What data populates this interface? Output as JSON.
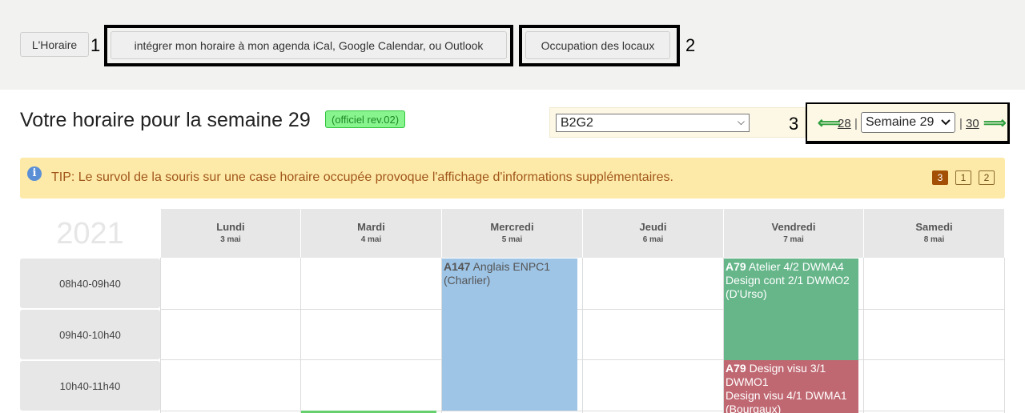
{
  "topbar": {
    "horaire_label": "L'Horaire",
    "ical_label": "intégrer mon horaire à mon agenda iCal, Google Calendar, ou Outlook",
    "locaux_label": "Occupation des locaux",
    "annotations": [
      "1",
      "2",
      "3"
    ]
  },
  "header": {
    "title": "Votre horaire pour la semaine 29",
    "badge": "(officiel rev.02)"
  },
  "group_select": {
    "value": "B2G2"
  },
  "week_nav": {
    "prev_week": "28",
    "current_week": "Semaine 29",
    "next_week": "30",
    "prev_arrow": "⟸",
    "next_arrow": "⟹",
    "separator": "|"
  },
  "tip": {
    "icon": "i",
    "text": "TIP: Le survol de la souris sur une case horaire occupée provoque l'affichage d'informations supplémentaires.",
    "pages": [
      "3",
      "1",
      "2"
    ]
  },
  "calendar": {
    "year": "2021",
    "days": [
      {
        "name": "Lundi",
        "date": "3 mai"
      },
      {
        "name": "Mardi",
        "date": "4 mai"
      },
      {
        "name": "Mercredi",
        "date": "5 mai"
      },
      {
        "name": "Jeudi",
        "date": "6 mai"
      },
      {
        "name": "Vendredi",
        "date": "7 mai"
      },
      {
        "name": "Samedi",
        "date": "8 mai"
      }
    ],
    "timeslots": [
      "08h40-09h40",
      "09h40-10h40",
      "10h40-11h40"
    ],
    "events": [
      {
        "room": "A147",
        "text": "Anglais ENPC1",
        "extra": "",
        "teacher": "(Charlier)"
      },
      {
        "room": "A79",
        "text": "Atelier 4/2 DWMA4",
        "extra": "Design cont 2/1 DWMO2",
        "teacher": "(D'Urso)"
      },
      {
        "room": "A79",
        "text": "Design visu 3/1",
        "extra": "DWMO1",
        "extra2": "Design visu 4/1 DWMA1",
        "teacher": "(Bourgaux)"
      }
    ]
  },
  "colors": {
    "event_blue": "#9ec4e6",
    "event_green": "#66b68a",
    "event_red": "#c06872",
    "badge_green": "#87f48e",
    "tip_bg": "#fdeaa8"
  }
}
